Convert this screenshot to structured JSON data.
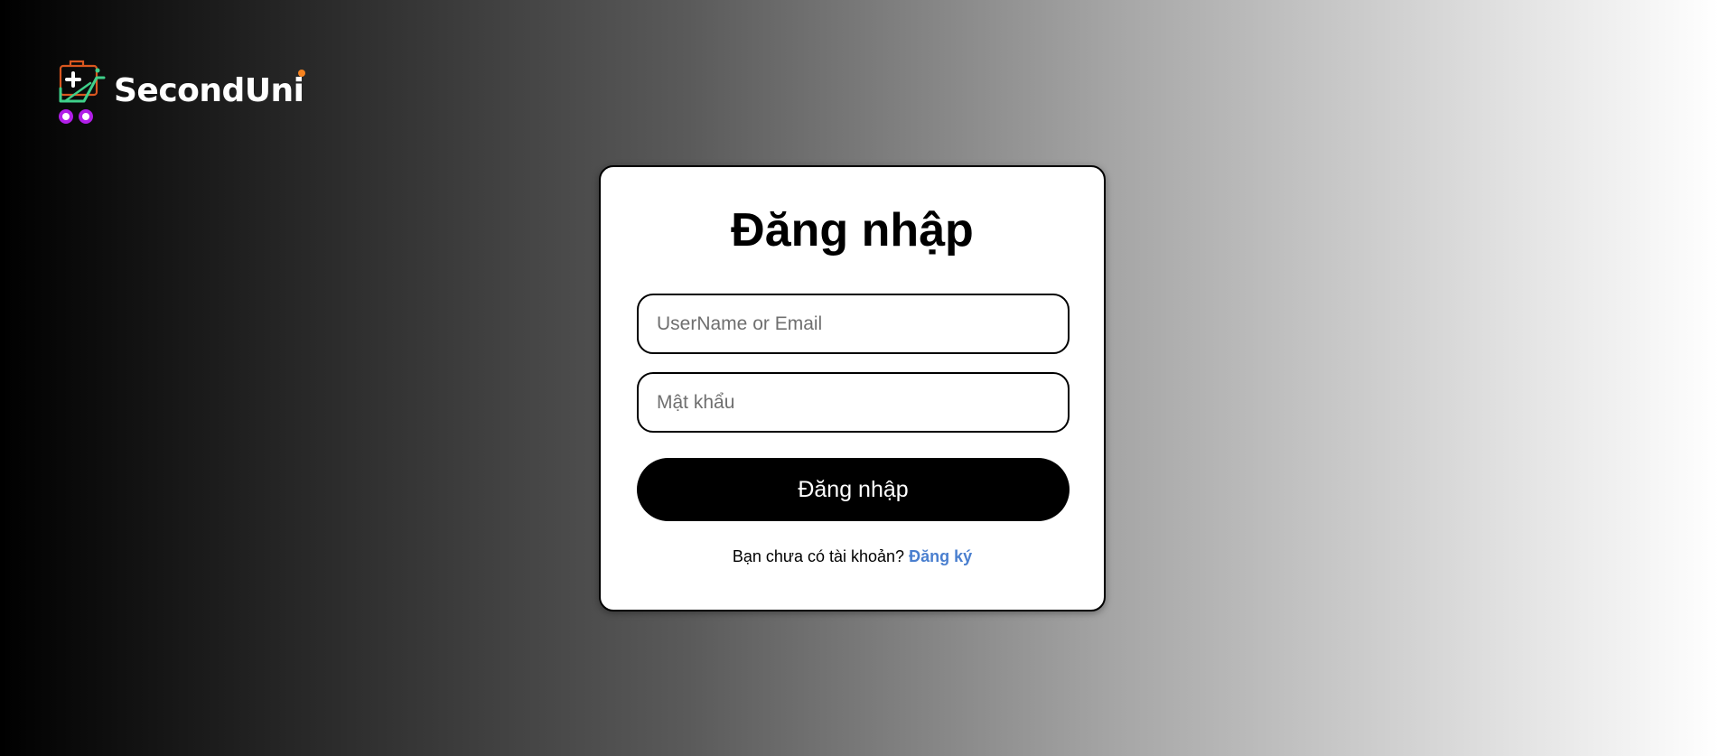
{
  "brand": {
    "name": "SecondUni",
    "accent_color": "#f5821f",
    "icon": "shopping-cart-plus-icon"
  },
  "login_form": {
    "title": "Đăng nhập",
    "username_placeholder": "UserName or Email",
    "username_value": "",
    "password_placeholder": "Mật khẩu",
    "password_value": "",
    "submit_label": "Đăng nhập",
    "signup_prompt": "Bạn chưa có tài khoản?",
    "signup_link": "Đăng ký",
    "link_color": "#4a7fcf"
  }
}
